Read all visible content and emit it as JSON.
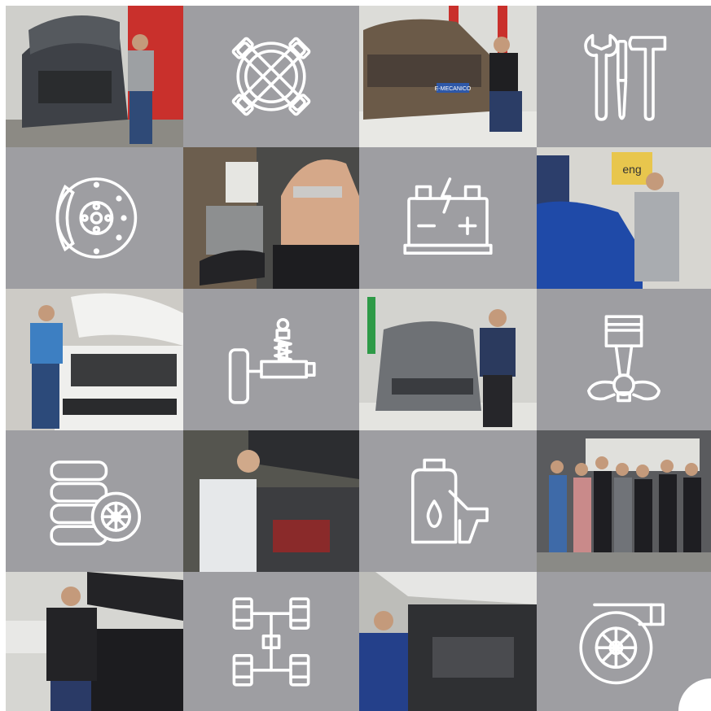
{
  "colors": {
    "tile_gray": "#9e9ea2",
    "icon_stroke": "#ffffff",
    "background": "#ffffff"
  },
  "tiles": [
    {
      "kind": "photo",
      "name": "photo-mechanic-hatchback-open-hood"
    },
    {
      "kind": "icon",
      "icon": "cross-tools-wheel-icon"
    },
    {
      "kind": "photo",
      "name": "photo-mechanic-renault-duster"
    },
    {
      "kind": "icon",
      "icon": "wrench-screwdriver-hammer-icon"
    },
    {
      "kind": "icon",
      "icon": "brake-disc-icon"
    },
    {
      "kind": "photo",
      "name": "photo-mechanic-brake-caliper"
    },
    {
      "kind": "icon",
      "icon": "car-battery-icon"
    },
    {
      "kind": "photo",
      "name": "photo-mechanic-blue-renault"
    },
    {
      "kind": "photo",
      "name": "photo-mechanic-fiat-open-hood"
    },
    {
      "kind": "icon",
      "icon": "shock-absorber-icon"
    },
    {
      "kind": "photo",
      "name": "photo-mechanic-gray-vw"
    },
    {
      "kind": "icon",
      "icon": "piston-icon"
    },
    {
      "kind": "icon",
      "icon": "tires-icon"
    },
    {
      "kind": "photo",
      "name": "photo-mechanic-engine-work"
    },
    {
      "kind": "icon",
      "icon": "oil-can-icon"
    },
    {
      "kind": "photo",
      "name": "photo-workshop-team"
    },
    {
      "kind": "photo",
      "name": "photo-mechanic-dark-pickup"
    },
    {
      "kind": "icon",
      "icon": "axle-chassis-icon"
    },
    {
      "kind": "photo",
      "name": "photo-mechanic-engine-bay"
    },
    {
      "kind": "icon",
      "icon": "turbocharger-icon"
    }
  ],
  "photo_badge": "E-MECANICO",
  "sign_text": "eng"
}
